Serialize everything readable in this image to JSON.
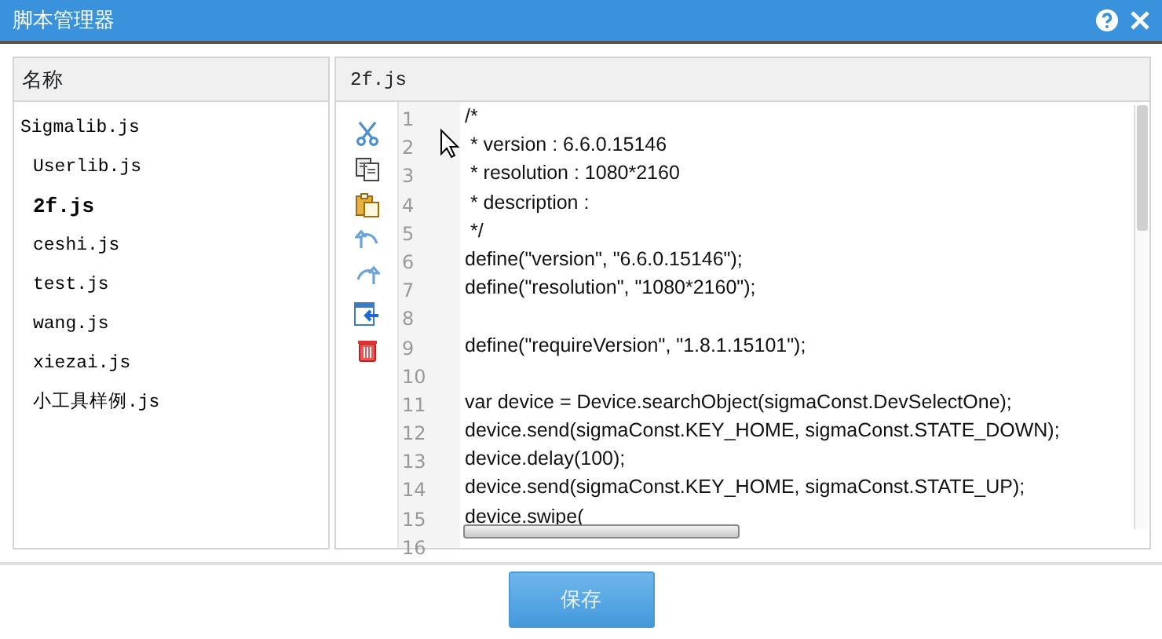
{
  "window": {
    "title": "脚本管理器"
  },
  "file_list": {
    "header": "名称",
    "items": [
      {
        "label": "Sigmalib.js",
        "selected": false
      },
      {
        "label": "Userlib.js",
        "selected": false
      },
      {
        "label": "2f.js",
        "selected": true
      },
      {
        "label": "ceshi.js",
        "selected": false
      },
      {
        "label": "test.js",
        "selected": false
      },
      {
        "label": "wang.js",
        "selected": false
      },
      {
        "label": "xiezai.js",
        "selected": false
      },
      {
        "label": "小工具样例.js",
        "selected": false
      }
    ]
  },
  "editor": {
    "header": "2f.js",
    "lines": [
      {
        "number": "1",
        "code": "/*"
      },
      {
        "number": "2",
        "code": " * version : 6.6.0.15146"
      },
      {
        "number": "3",
        "code": " * resolution : 1080*2160"
      },
      {
        "number": "4",
        "code": " * description :"
      },
      {
        "number": "5",
        "code": " */"
      },
      {
        "number": "6",
        "code": "define(\"version\", \"6.6.0.15146\");"
      },
      {
        "number": "7",
        "code": "define(\"resolution\", \"1080*2160\");"
      },
      {
        "number": "8"
      },
      {
        "number": "9",
        "code": "define(\"requireVersion\", \"1.8.1.15101\");"
      },
      {
        "number": "10"
      },
      {
        "number": "11",
        "code": "var device = Device.searchObject(sigmaConst.DevSelectOne);"
      },
      {
        "number": "12",
        "code": "device.send(sigmaConst.KEY_HOME, sigmaConst.STATE_DOWN);"
      },
      {
        "number": "13",
        "code": "device.delay(100);"
      },
      {
        "number": "14",
        "code": "device.send(sigmaConst.KEY_HOME, sigmaConst.STATE_UP);"
      },
      {
        "number": "15",
        "code": "device.swipe("
      },
      {
        "number": "16"
      }
    ]
  },
  "save_button": {
    "label": "保存",
    "disabled": true
  }
}
